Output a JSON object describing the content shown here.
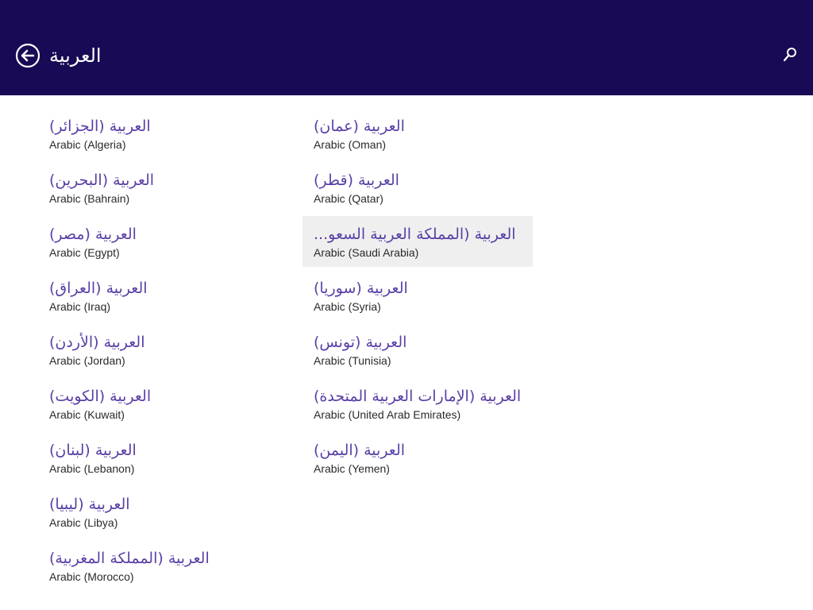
{
  "header": {
    "title": "العربية",
    "back_icon": "back-arrow-circle-icon",
    "search_icon": "search-icon"
  },
  "colors": {
    "header_bg": "#180a54",
    "native_text": "#5a3fa6",
    "english_text": "#2a2a2a",
    "selected_bg": "#efefef"
  },
  "languages": {
    "col1": [
      {
        "native": "العربية (الجزائر)",
        "english": "Arabic (Algeria)"
      },
      {
        "native": "العربية (البحرين)",
        "english": "Arabic (Bahrain)"
      },
      {
        "native": "العربية (مصر)",
        "english": "Arabic (Egypt)"
      },
      {
        "native": "العربية (العراق)",
        "english": "Arabic (Iraq)"
      },
      {
        "native": "العربية (الأردن)",
        "english": "Arabic (Jordan)"
      },
      {
        "native": "العربية (الكويت)",
        "english": "Arabic (Kuwait)"
      },
      {
        "native": "العربية (لبنان)",
        "english": "Arabic (Lebanon)"
      },
      {
        "native": "العربية (ليبيا)",
        "english": "Arabic (Libya)"
      },
      {
        "native": "العربية (المملكة المغربية)",
        "english": "Arabic (Morocco)"
      }
    ],
    "col2": [
      {
        "native": "العربية (عمان)",
        "english": "Arabic (Oman)"
      },
      {
        "native": "العربية (قطر)",
        "english": "Arabic (Qatar)"
      },
      {
        "native": "...العربية (المملكة العربية السعو",
        "english": "Arabic (Saudi Arabia)",
        "selected": true
      },
      {
        "native": "العربية (سوريا)",
        "english": "Arabic (Syria)"
      },
      {
        "native": "العربية (تونس)",
        "english": "Arabic (Tunisia)"
      },
      {
        "native": "العربية (الإمارات العربية المتحدة)",
        "english": "Arabic (United Arab Emirates)"
      },
      {
        "native": "العربية (اليمن)",
        "english": "Arabic (Yemen)"
      }
    ]
  }
}
